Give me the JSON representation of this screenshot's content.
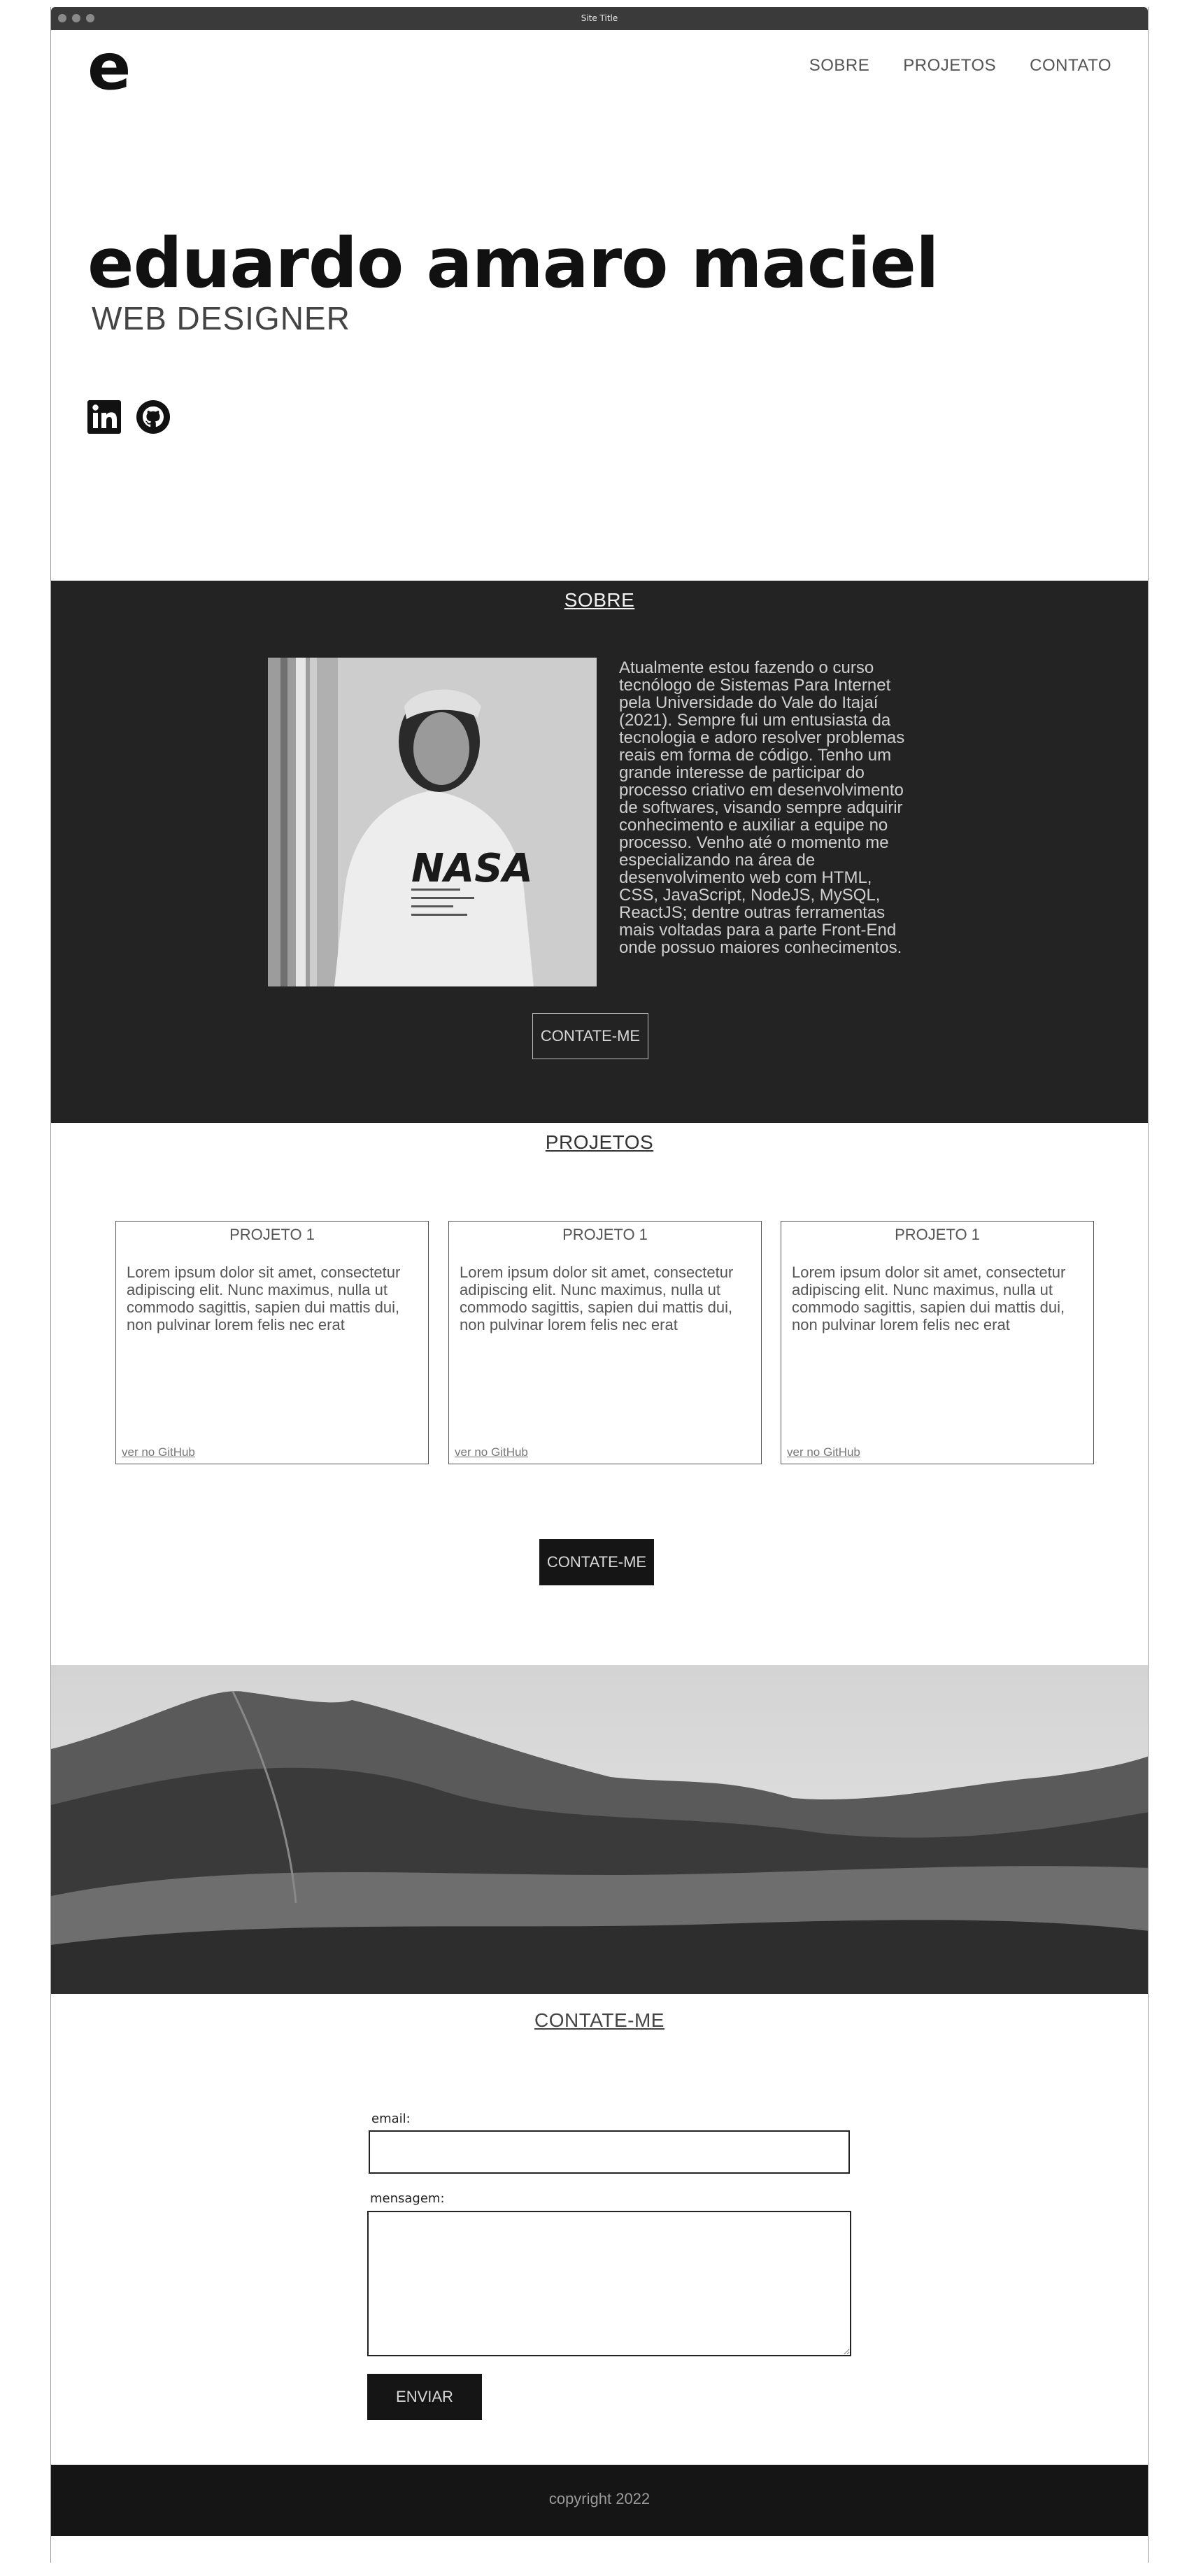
{
  "window": {
    "title": "Site Title"
  },
  "header": {
    "logo": "e",
    "nav": [
      "SOBRE",
      "PROJETOS",
      "CONTATO"
    ]
  },
  "hero": {
    "name": "eduardo amaro maciel",
    "role": "WEB DESIGNER",
    "socials": [
      "linkedin-icon",
      "github-icon"
    ]
  },
  "sobre": {
    "title": "SOBRE",
    "text": "Atualmente estou fazendo o curso tecnólogo de Sistemas Para Internet pela Universidade do Vale do Itajaí (2021). Sempre fui um entusiasta da tecnologia e adoro resolver problemas reais em forma de código. Tenho um grande interesse de participar do processo criativo em desenvolvimento de softwares, visando sempre adquirir conhecimento e auxiliar a equipe no processo. Venho até o momento me especializando na área de desenvolvimento web com HTML, CSS, JavaScript, NodeJS, MySQL, ReactJS; dentre outras ferramentas mais voltadas para a parte Front-End onde possuo maiores conhecimentos.",
    "button": "CONTATE-ME",
    "photo_text": "NASA"
  },
  "projetos": {
    "title": "PROJETOS",
    "cards": [
      {
        "title": "PROJETO 1",
        "text": "Lorem ipsum dolor sit amet, consectetur adipiscing elit. Nunc maximus, nulla ut commodo sagittis, sapien dui mattis dui, non pulvinar lorem felis nec erat",
        "link": "ver no GitHub"
      },
      {
        "title": "PROJETO 1",
        "text": "Lorem ipsum dolor sit amet, consectetur adipiscing elit. Nunc maximus, nulla ut commodo sagittis, sapien dui mattis dui, non pulvinar lorem felis nec erat",
        "link": "ver no GitHub"
      },
      {
        "title": "PROJETO 1",
        "text": "Lorem ipsum dolor sit amet, consectetur adipiscing elit. Nunc maximus, nulla ut commodo sagittis, sapien dui mattis dui, non pulvinar lorem felis nec erat",
        "link": "ver no GitHub"
      }
    ],
    "button": "CONTATE-ME"
  },
  "contato": {
    "title": "CONTATE-ME",
    "email_label": "email:",
    "email_value": "",
    "message_label": "mensagem:",
    "message_value": "",
    "submit": "ENVIAR"
  },
  "footer": {
    "copyright": "copyright 2022"
  },
  "colors": {
    "dark": "#232323",
    "darker": "#151515",
    "text": "#222222"
  }
}
